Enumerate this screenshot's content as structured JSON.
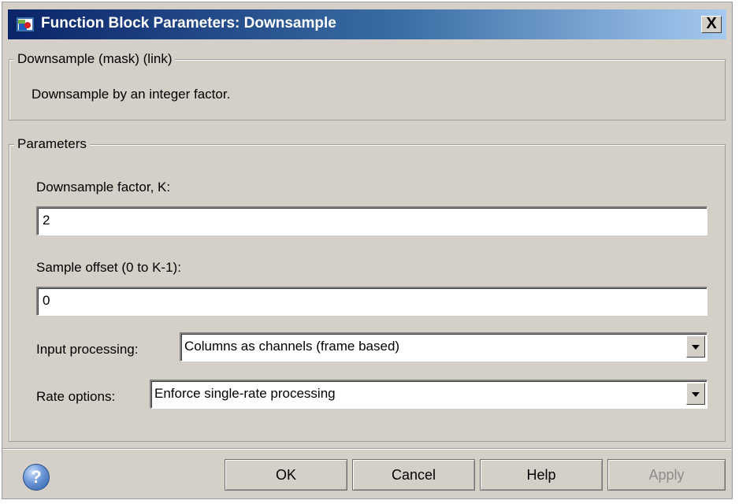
{
  "window": {
    "title": "Function Block Parameters: Downsample",
    "close_label": "X"
  },
  "description_group": {
    "legend": "Downsample (mask) (link)",
    "text": "Downsample by an integer  factor."
  },
  "parameters_group": {
    "legend": "Parameters",
    "factor_label": "Downsample factor, K:",
    "factor_value": "2",
    "offset_label": "Sample offset (0 to K-1):",
    "offset_value": "0",
    "input_processing_label": "Input processing:",
    "input_processing_value": "Columns as channels (frame based)",
    "rate_options_label": "Rate options:",
    "rate_options_value": "Enforce single-rate processing"
  },
  "buttons": {
    "help_icon_glyph": "?",
    "ok": "OK",
    "cancel": "Cancel",
    "help": "Help",
    "apply": "Apply"
  },
  "icons": {
    "title_icon": "simulink-block-icon",
    "help_icon": "question-circle-icon",
    "dropdown_icon": "chevron-down-icon"
  },
  "colors": {
    "title_gradient_start": "#0a246a",
    "title_gradient_end": "#a6caf0",
    "dialog_background": "#d4d0c8",
    "disabled_text": "#8c8c8c"
  }
}
